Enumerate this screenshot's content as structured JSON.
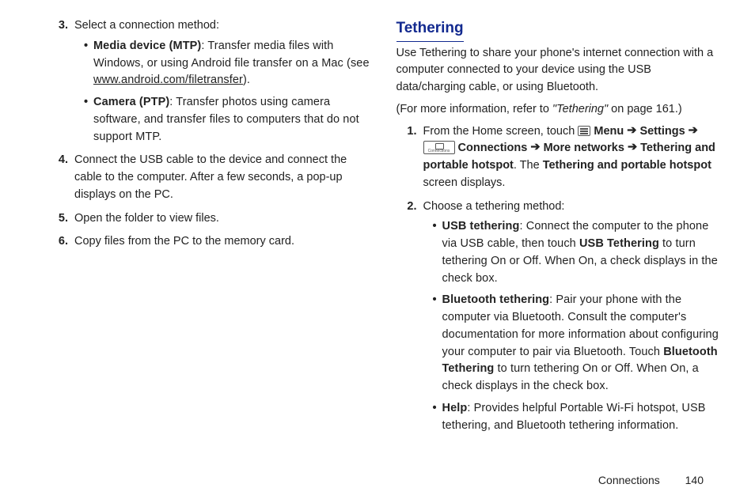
{
  "left": {
    "items": [
      {
        "num": "3.",
        "text": "Select a connection method:",
        "bullets": [
          {
            "label": "Media device (MTP)",
            "text_before": ": Transfer media files with Windows, or using Android file transfer on a Mac (see ",
            "link": "www.android.com/filetransfer",
            "text_after": ")."
          },
          {
            "label": "Camera (PTP)",
            "text_before": ": Transfer photos using camera software, and transfer files to computers that do not support MTP.",
            "link": "",
            "text_after": ""
          }
        ]
      },
      {
        "num": "4.",
        "text": "Connect the USB cable to the device and connect the cable to the computer. After a few seconds, a pop-up displays on the PC."
      },
      {
        "num": "5.",
        "text": "Open the folder to view files."
      },
      {
        "num": "6.",
        "text": "Copy files from the PC to the memory card."
      }
    ]
  },
  "right": {
    "heading": "Tethering",
    "intro": "Use Tethering to share your phone's internet connection with a computer connected to your device using the USB data/charging cable, or using Bluetooth.",
    "ref_before": "(For more information, refer to ",
    "ref_ital": "\"Tethering\"",
    "ref_after": " on page 161.)",
    "step1": {
      "num": "1.",
      "pre": "From the Home screen, touch ",
      "menu": "Menu",
      "arrow": "➔",
      "settings": "Settings",
      "connections": "Connections",
      "more_networks": "More networks",
      "tether_label": "Tethering and portable hotspot",
      "post_before_the": ". The ",
      "tether_label2": "Tethering and portable hotspot",
      "post_after": " screen displays."
    },
    "step2": {
      "num": "2.",
      "text": "Choose a tethering method:",
      "bullets": [
        {
          "label": "USB tethering",
          "t1": ": Connect the computer to the phone via USB cable, then touch ",
          "b1": "USB Tethering",
          "t2": " to turn tethering On or Off. When On, a check displays in the check box."
        },
        {
          "label": "Bluetooth tethering",
          "t1": ": Pair your phone with the computer via Bluetooth. Consult the computer's documentation for more information about configuring your computer to pair via Bluetooth. Touch ",
          "b1": "Bluetooth Tethering",
          "t2": " to turn tethering On or Off. When On, a check displays in the check box."
        },
        {
          "label": "Help",
          "t1": ": Provides helpful Portable Wi-Fi hotspot, USB tethering, and Bluetooth tethering information.",
          "b1": "",
          "t2": ""
        }
      ]
    }
  },
  "footer": {
    "section": "Connections",
    "page": "140"
  }
}
